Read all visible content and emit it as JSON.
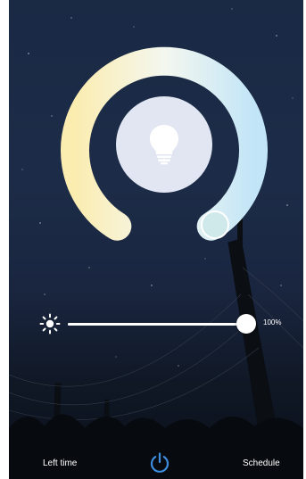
{
  "light": {
    "power_on": true,
    "brightness_percent": 100,
    "brightness_label": "100%",
    "color_temp_position": 1.0
  },
  "bottom_bar": {
    "left_time_label": "Left time",
    "schedule_label": "Schedule"
  },
  "icons": {
    "bulb": "lightbulb-icon",
    "brightness": "sun-icon",
    "power": "power-icon"
  },
  "colors": {
    "warm": "#fbecb0",
    "neutral": "#f4f7ef",
    "cool": "#c2e5f7",
    "power_accent": "#3d8ee0"
  }
}
